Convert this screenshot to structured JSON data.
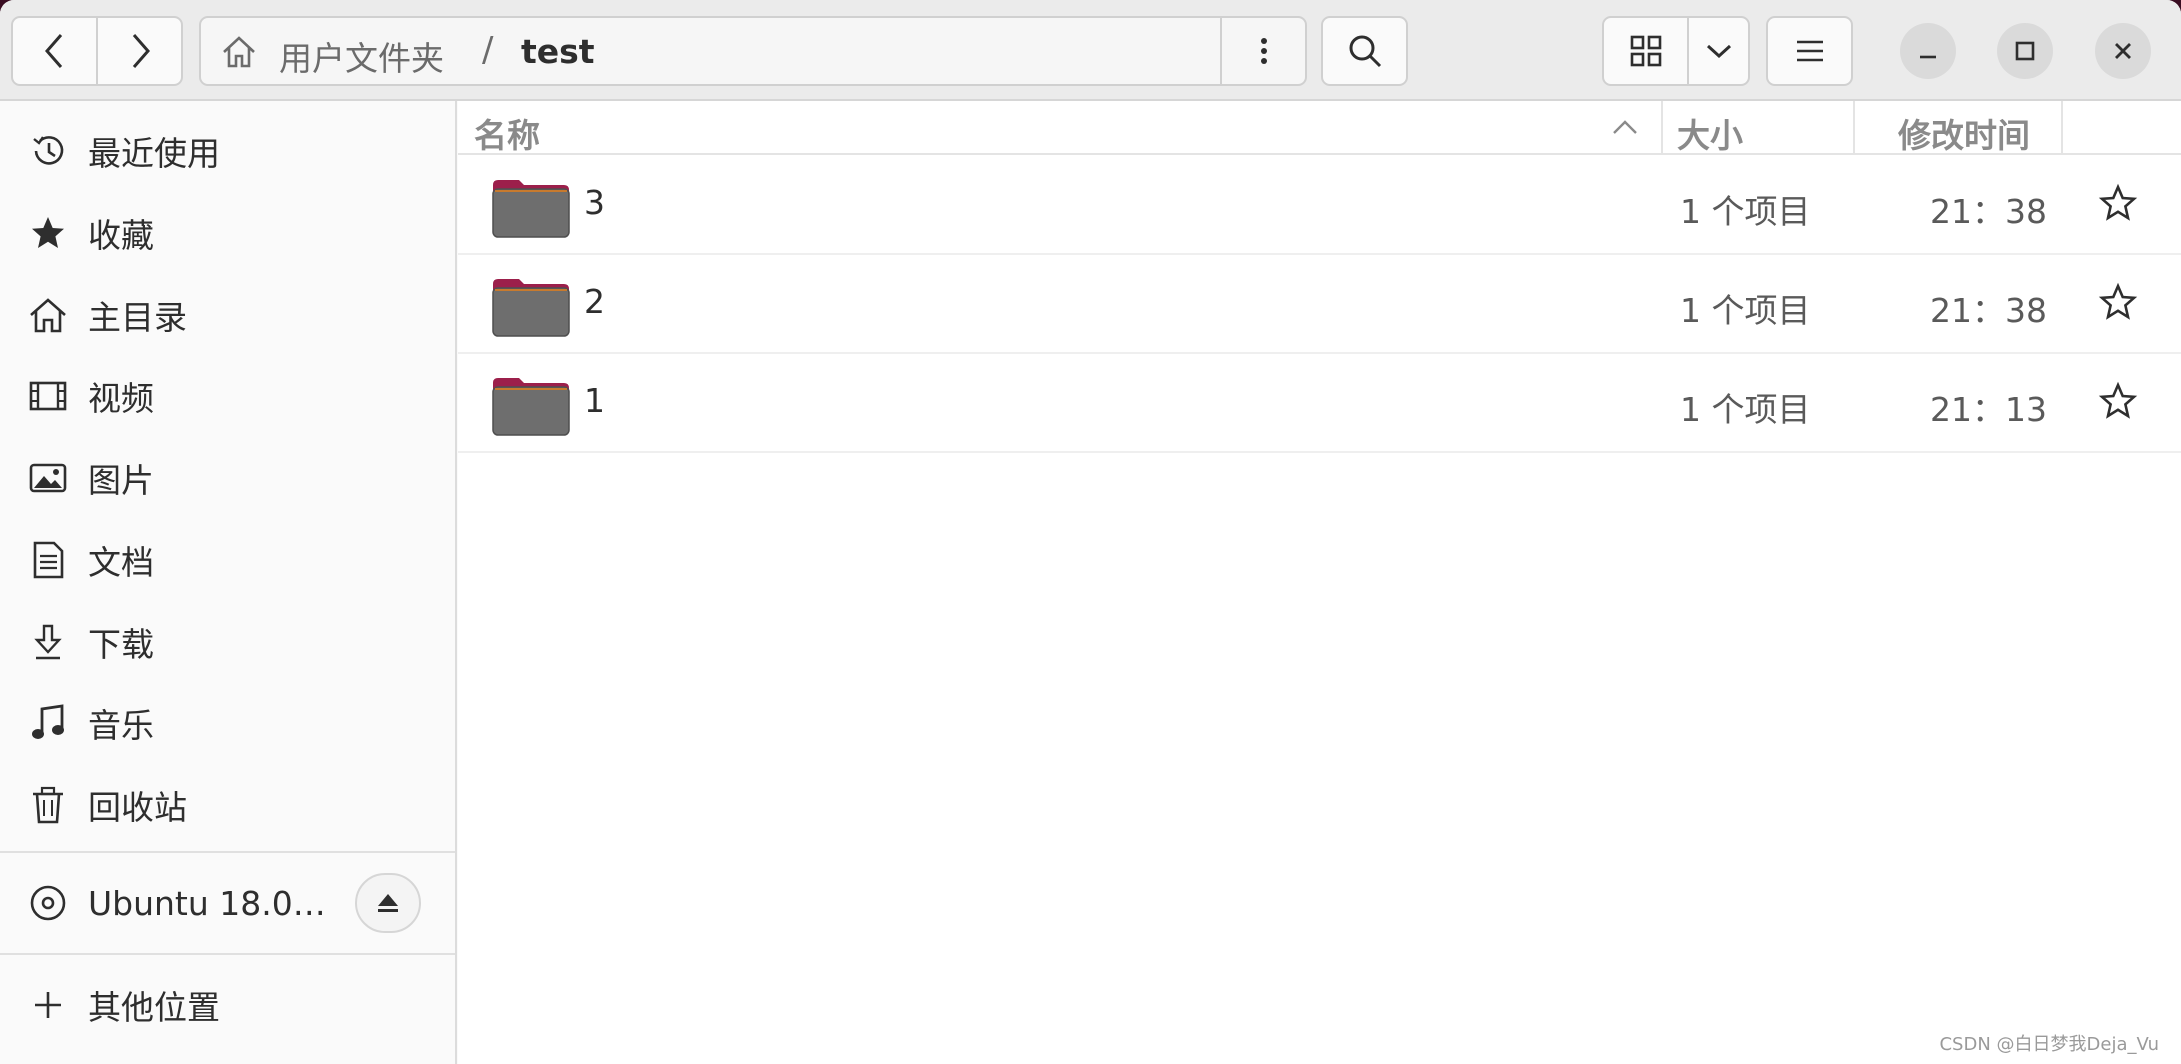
{
  "header": {
    "path_parent": "用户文件夹",
    "path_separator": "/",
    "path_current": "test"
  },
  "sidebar": {
    "items": [
      {
        "label": "最近使用",
        "icon": "recent-icon"
      },
      {
        "label": "收藏",
        "icon": "star-icon"
      },
      {
        "label": "主目录",
        "icon": "home-icon"
      },
      {
        "label": "视频",
        "icon": "video-icon"
      },
      {
        "label": "图片",
        "icon": "picture-icon"
      },
      {
        "label": "文档",
        "icon": "document-icon"
      },
      {
        "label": "下载",
        "icon": "download-icon"
      },
      {
        "label": "音乐",
        "icon": "music-icon"
      },
      {
        "label": "回收站",
        "icon": "trash-icon"
      }
    ],
    "device": {
      "label": "Ubuntu 18.0…",
      "icon": "disc-icon"
    },
    "other": {
      "label": "其他位置",
      "icon": "plus-icon"
    }
  },
  "columns": {
    "name": "名称",
    "size": "大小",
    "modified": "修改时间"
  },
  "files": [
    {
      "name": "3",
      "size": "1 个项目",
      "modified": "21：38"
    },
    {
      "name": "2",
      "size": "1 个项目",
      "modified": "21：38"
    },
    {
      "name": "1",
      "size": "1 个项目",
      "modified": "21：13"
    }
  ],
  "colors": {
    "folder_tab": "#9c1f4b",
    "folder_body": "#6e6e6e",
    "titlebar_bg": "#ebebeb"
  },
  "watermark": "CSDN @白日梦我Deja_Vu"
}
